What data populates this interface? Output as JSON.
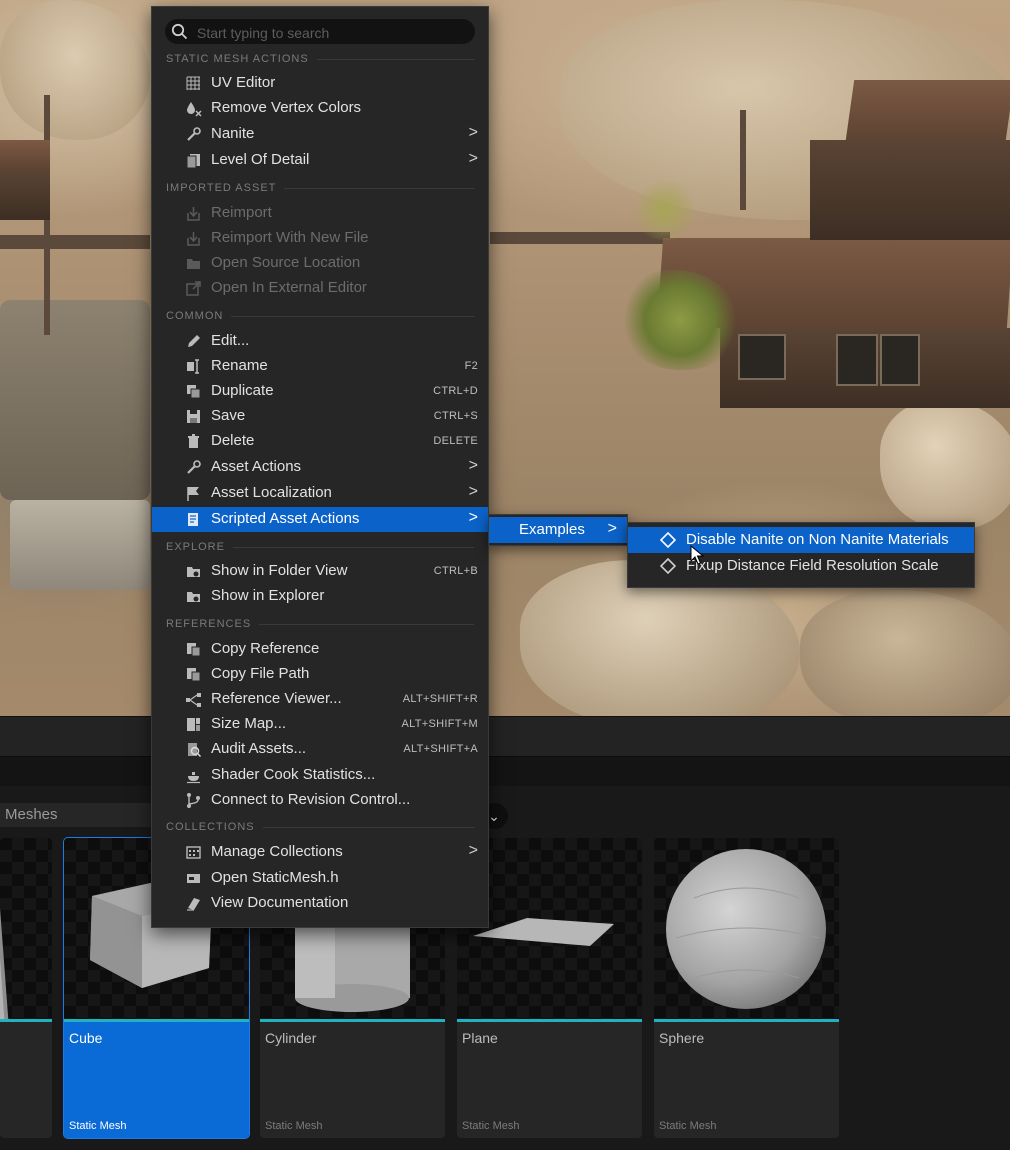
{
  "search": {
    "placeholder": "Start typing to search"
  },
  "menu": {
    "sections": {
      "static_mesh_actions": "STATIC MESH ACTIONS",
      "imported_asset": "IMPORTED ASSET",
      "common": "COMMON",
      "explore": "EXPLORE",
      "references": "REFERENCES",
      "collections": "COLLECTIONS"
    },
    "items": {
      "uv_editor": "UV Editor",
      "remove_vertex_colors": "Remove Vertex Colors",
      "nanite": "Nanite",
      "level_of_detail": "Level Of Detail",
      "reimport": "Reimport",
      "reimport_new_file": "Reimport With New File",
      "open_source_location": "Open Source Location",
      "open_external_editor": "Open In External Editor",
      "edit": "Edit...",
      "rename": "Rename",
      "duplicate": "Duplicate",
      "save": "Save",
      "delete": "Delete",
      "asset_actions": "Asset Actions",
      "asset_localization": "Asset Localization",
      "scripted_asset_actions": "Scripted Asset Actions",
      "show_in_folder_view": "Show in Folder View",
      "show_in_explorer": "Show in Explorer",
      "copy_reference": "Copy Reference",
      "copy_file_path": "Copy File Path",
      "reference_viewer": "Reference Viewer...",
      "size_map": "Size Map...",
      "audit_assets": "Audit Assets...",
      "shader_cook_statistics": "Shader Cook Statistics...",
      "connect_revision_control": "Connect to Revision Control...",
      "manage_collections": "Manage Collections",
      "open_staticmesh_h": "Open StaticMesh.h",
      "view_documentation": "View Documentation"
    },
    "shortcuts": {
      "rename": "F2",
      "duplicate": "CTRL+D",
      "save": "CTRL+S",
      "delete": "DELETE",
      "show_in_folder_view": "CTRL+B",
      "reference_viewer": "ALT+SHIFT+R",
      "size_map": "ALT+SHIFT+M",
      "audit_assets": "ALT+SHIFT+A"
    },
    "submenu_arrow": ">"
  },
  "submenu_examples": {
    "label": "Examples"
  },
  "submenu_scripts": {
    "items": [
      "Disable Nanite on Non Nanite Materials",
      "Fixup Distance Field Resolution Scale"
    ]
  },
  "content_browser": {
    "path_label": "Meshes",
    "filter_chevron": "⌄",
    "tiles": [
      {
        "name": "Cube",
        "type": "Static Mesh"
      },
      {
        "name": "Cylinder",
        "type": "Static Mesh"
      },
      {
        "name": "Plane",
        "type": "Static Mesh"
      },
      {
        "name": "Sphere",
        "type": "Static Mesh"
      }
    ]
  },
  "colors": {
    "menu_bg": "#262626",
    "highlight": "#0b62c8",
    "tile_selected": "#0a6ad6",
    "tile_accent": "#1fb3c2"
  }
}
